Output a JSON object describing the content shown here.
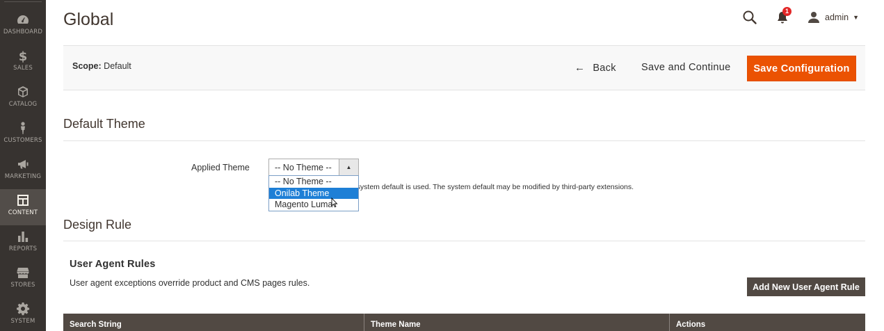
{
  "sidebar": {
    "items": [
      {
        "label": "DASHBOARD",
        "icon": "dashboard-icon"
      },
      {
        "label": "SALES",
        "icon": "dollar-icon"
      },
      {
        "label": "CATALOG",
        "icon": "cube-icon"
      },
      {
        "label": "CUSTOMERS",
        "icon": "person-icon"
      },
      {
        "label": "MARKETING",
        "icon": "megaphone-icon"
      },
      {
        "label": "CONTENT",
        "icon": "layout-icon",
        "active": true
      },
      {
        "label": "REPORTS",
        "icon": "bar-chart-icon"
      },
      {
        "label": "STORES",
        "icon": "storefront-icon"
      },
      {
        "label": "SYSTEM",
        "icon": "gear-icon"
      }
    ]
  },
  "header": {
    "title": "Global",
    "notifications_count": "1",
    "user_name": "admin"
  },
  "actions": {
    "scope_label": "Scope:",
    "scope_value": "Default",
    "back_label": "Back",
    "save_continue_label": "Save and Continue",
    "save_config_label": "Save Configuration"
  },
  "default_theme": {
    "section_title": "Default Theme",
    "field_label": "Applied Theme",
    "selected_value": "-- No Theme --",
    "options": [
      "-- No Theme --",
      "Onilab Theme",
      "Magento Luma"
    ],
    "highlighted_option": "Onilab Theme",
    "note": "If no value is specified, the system default is used. The system default may be modified by third-party extensions."
  },
  "design_rule": {
    "section_title": "Design Rule",
    "subsection_title": "User Agent Rules",
    "description": "User agent exceptions override product and CMS pages rules.",
    "add_button_label": "Add New User Agent Rule",
    "table_columns": [
      "Search String",
      "Theme Name",
      "Actions"
    ]
  },
  "colors": {
    "sidebar_bg": "#373330",
    "accent_orange": "#eb5202",
    "dark_button": "#514943",
    "highlight_blue": "#1e7fd6"
  }
}
